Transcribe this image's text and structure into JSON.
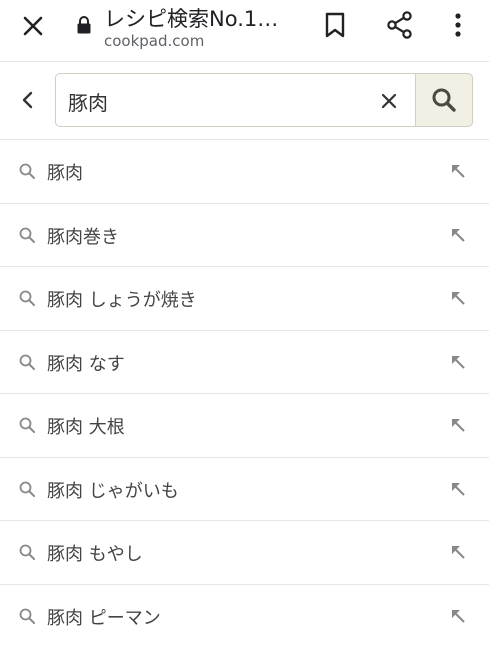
{
  "browser": {
    "title": "レシピ検索No.1…",
    "url": "cookpad.com"
  },
  "search": {
    "query": "豚肉"
  },
  "suggestions": [
    {
      "label": "豚肉"
    },
    {
      "label": "豚肉巻き"
    },
    {
      "label": "豚肉 しょうが焼き"
    },
    {
      "label": "豚肉 なす"
    },
    {
      "label": "豚肉 大根"
    },
    {
      "label": "豚肉 じゃがいも"
    },
    {
      "label": "豚肉 もやし"
    },
    {
      "label": "豚肉 ピーマン"
    }
  ],
  "icons": {
    "close": "close-icon",
    "lock": "lock-icon",
    "bookmark": "bookmark-icon",
    "share": "share-icon",
    "more": "more-vert-icon",
    "back": "chevron-left-icon",
    "clear": "clear-icon",
    "search": "search-icon",
    "suggestion": "search-icon",
    "fill": "arrow-up-left-icon"
  },
  "colors": {
    "search_button_bg": "#f2efe4",
    "border": "#cfcfc4"
  }
}
